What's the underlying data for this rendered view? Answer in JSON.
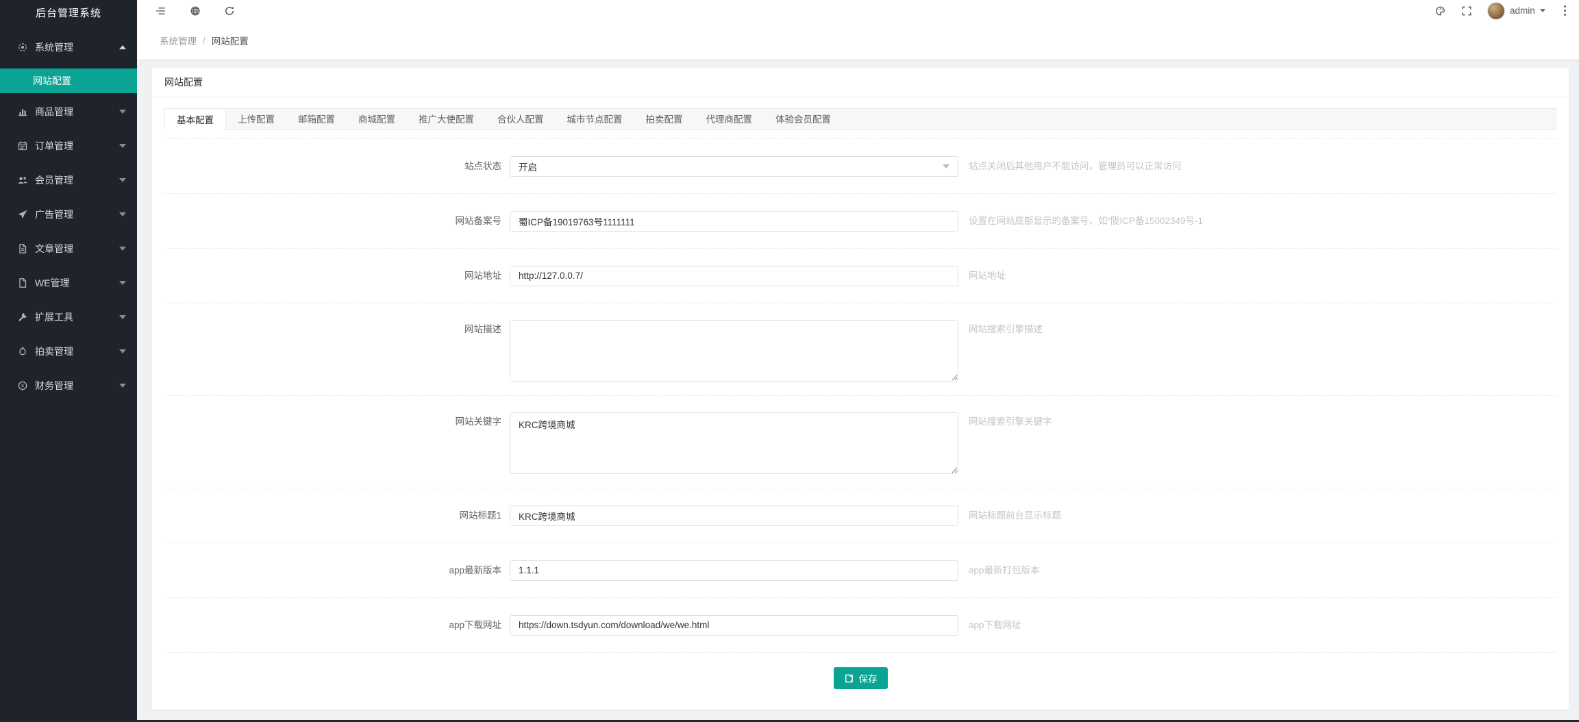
{
  "colors": {
    "accent": "#0ba393",
    "sidebar_bg": "#1f232c"
  },
  "sidebar": {
    "title": "后台管理系统",
    "menus": [
      {
        "label": "系统管理",
        "icon": "gear-icon",
        "expanded": true
      },
      {
        "label": "商品管理",
        "icon": "bar-chart-icon"
      },
      {
        "label": "订单管理",
        "icon": "calendar-icon"
      },
      {
        "label": "会员管理",
        "icon": "users-icon"
      },
      {
        "label": "广告管理",
        "icon": "paper-plane-icon"
      },
      {
        "label": "文章管理",
        "icon": "document-icon"
      },
      {
        "label": "WE管理",
        "icon": "document-icon"
      },
      {
        "label": "扩展工具",
        "icon": "wrench-icon"
      },
      {
        "label": "拍卖管理",
        "icon": "fire-icon"
      },
      {
        "label": "财务管理",
        "icon": "yen-circle-icon"
      }
    ],
    "submenu": {
      "label": "网站配置",
      "active": true
    }
  },
  "topbar": {
    "user": "admin"
  },
  "breadcrumb": {
    "items": [
      "系统管理",
      "网站配置"
    ],
    "separator": "/"
  },
  "page": {
    "card_title": "网站配置"
  },
  "tabs": {
    "active": "基本配置",
    "items": [
      "基本配置",
      "上传配置",
      "邮箱配置",
      "商城配置",
      "推广大使配置",
      "合伙人配置",
      "城市节点配置",
      "拍卖配置",
      "代理商配置",
      "体验会员配置"
    ]
  },
  "form": {
    "rows": [
      {
        "label": "站点状态",
        "type": "select",
        "value": "开启",
        "hint": "站点关闭后其他用户不能访问，管理员可以正常访问"
      },
      {
        "label": "网站备案号",
        "type": "input",
        "value": "蜀ICP备19019763号1111111",
        "hint": "设置在网站底部显示的备案号，如“陇ICP备15002349号-1"
      },
      {
        "label": "网站地址",
        "type": "input",
        "value": "http://127.0.0.7/",
        "hint": "网站地址"
      },
      {
        "label": "网站描述",
        "type": "textarea",
        "value": "",
        "hint": "网站搜索引擎描述"
      },
      {
        "label": "网站关键字",
        "type": "textarea",
        "value": "KRC跨境商城",
        "hint": "网站搜索引擎关键字"
      },
      {
        "label": "网站标题1",
        "type": "input",
        "value": "KRC跨境商城",
        "hint": "网站标题前台显示标题"
      },
      {
        "label": "app最新版本",
        "type": "input",
        "value": "1.1.1",
        "hint": "app最新打包版本"
      },
      {
        "label": "app下载网址",
        "type": "input",
        "value": "https://down.tsdyun.com/download/we/we.html",
        "hint": "app下载网址"
      }
    ],
    "save_label": "保存"
  }
}
